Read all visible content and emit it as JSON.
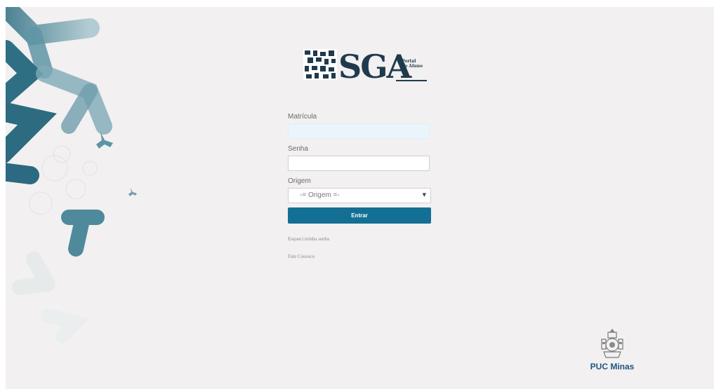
{
  "logo": {
    "title": "SGA",
    "subtitle_line1": "Portal",
    "subtitle_line2": "do Aluno"
  },
  "form": {
    "matricula": {
      "label": "Matrícula",
      "value": "",
      "placeholder": ""
    },
    "senha": {
      "label": "Senha",
      "value": "",
      "placeholder": ""
    },
    "origem": {
      "label": "Origem",
      "selected": "-= Origem =-"
    },
    "submit_label": "Entrar"
  },
  "links": {
    "forgot": "Esqueci minha senha",
    "contact": "Fale Conosco"
  },
  "footer": {
    "brand": "PUC Minas"
  },
  "colors": {
    "accent": "#137094",
    "background": "#f2f0f0",
    "brand_dark": "#1f3a4d",
    "puc_blue": "#1e5580"
  }
}
